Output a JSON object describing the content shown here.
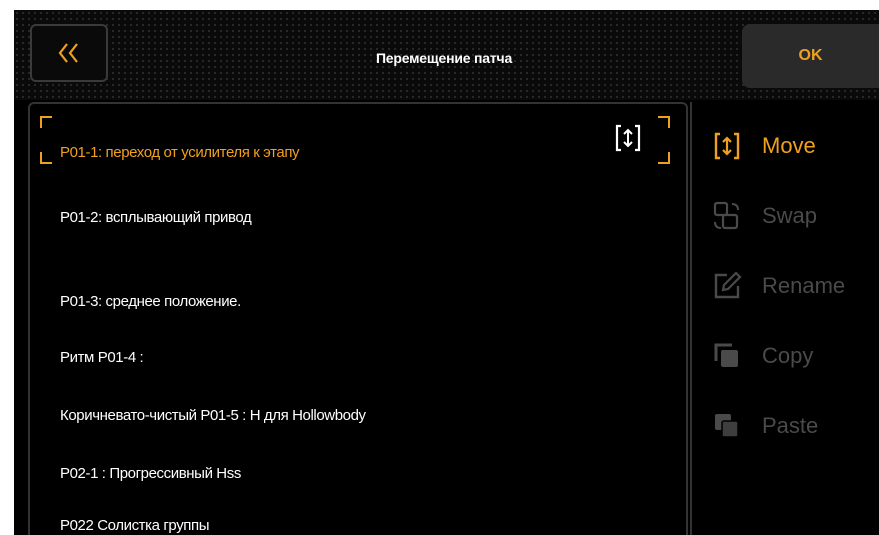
{
  "header": {
    "back_glyph": "❬❬",
    "title": "Перемещение патча",
    "ok_label": "OK"
  },
  "patches": [
    {
      "label": "P01-1: переход от усилителя к этапу",
      "selected": true
    },
    {
      "label": "P01-2: всплывающий привод",
      "selected": false
    },
    {
      "label": "P01-3: среднее положение.",
      "selected": false
    },
    {
      "label": "Ритм P01-4 :",
      "selected": false
    },
    {
      "label": "Коричневато-чистый P01-5 : H для Hollowbody",
      "selected": false
    },
    {
      "label": "P02-1 : Прогрессивный Hss",
      "selected": false
    },
    {
      "label": "P022 Солистка группы",
      "selected": false
    }
  ],
  "side_menu": [
    {
      "label": "Move",
      "icon": "move-icon",
      "active": true
    },
    {
      "label": "Swap",
      "icon": "swap-icon",
      "active": false
    },
    {
      "label": "Rename",
      "icon": "rename-icon",
      "active": false
    },
    {
      "label": "Copy",
      "icon": "copy-icon",
      "active": false
    },
    {
      "label": "Paste",
      "icon": "paste-icon",
      "active": false
    }
  ],
  "colors": {
    "accent": "#f0a020",
    "inactive": "#4a4a4a",
    "background": "#000000"
  }
}
